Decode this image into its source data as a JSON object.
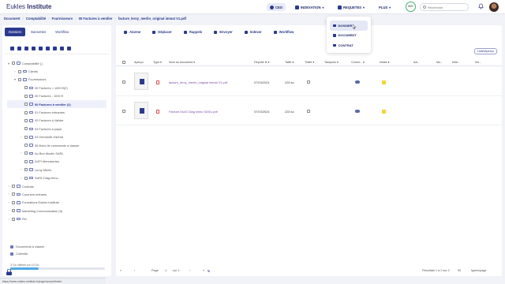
{
  "app": {
    "logo_light": "Eukles ",
    "logo_bold": "Institute"
  },
  "nav": {
    "ceo": "CEO",
    "indexation": "INDEXATION",
    "requetes": "REQUETES",
    "plus": "PLUS",
    "quota_pct": "68%"
  },
  "search": {
    "placeholder": "Recherche"
  },
  "breadcrumb": [
    "Document",
    "Comptabilité",
    "Fournisseurs",
    "00 Factures à ventiler",
    "facture_leroy_merlin_original immat V1.pdf"
  ],
  "sidebar": {
    "tabs": [
      "Dossiers",
      "Bannettes",
      "Workflow"
    ],
    "tree": [
      {
        "label": "Comptabilité (.)",
        "level": 0,
        "exp": "▾"
      },
      {
        "label": "Clients",
        "level": 1,
        "exp": "›"
      },
      {
        "label": "Fournisseurs",
        "level": 1,
        "exp": "▾"
      },
      {
        "label": "00 Factures < 1000 €(2)",
        "level": 2,
        "exp": ""
      },
      {
        "label": "00 Factures - 1000 €",
        "level": 2,
        "exp": ""
      },
      {
        "label": "00 Factures à ventiler (2)",
        "level": 2,
        "exp": "",
        "sel": true
      },
      {
        "label": "01 Factures entrantes",
        "level": 2,
        "exp": ""
      },
      {
        "label": "02 Factures à Valider",
        "level": 2,
        "exp": ""
      },
      {
        "label": "03 Factures à payer",
        "level": 2,
        "exp": ""
      },
      {
        "label": "04 Demande d'achat",
        "level": 2,
        "exp": "›"
      },
      {
        "label": "05 Bons de commande à classer",
        "level": 2,
        "exp": ""
      },
      {
        "label": "Au Bon Moulin SARL",
        "level": 2,
        "exp": "›"
      },
      {
        "label": "AXPI Menuiseries",
        "level": 2,
        "exp": ""
      },
      {
        "label": "Leroy Merlin",
        "level": 2,
        "exp": "›"
      },
      {
        "label": "SARL Diag immo",
        "level": 2,
        "exp": "›"
      },
      {
        "label": "Contrats",
        "level": 0,
        "exp": "›"
      },
      {
        "label": "Courriers entrants",
        "level": 0,
        "exp": "›"
      },
      {
        "label": "Formations Eukles Institute",
        "level": 0,
        "exp": "›"
      },
      {
        "label": "Marketing Communication (5)",
        "level": 0,
        "exp": "›"
      },
      {
        "label": "RH",
        "level": 0,
        "exp": "›"
      }
    ],
    "links": [
      "Documents à classer",
      "Corbeille"
    ],
    "quota_text": "3 Go utilisés sur 10 Go",
    "quota_fraction": 0.3
  },
  "toolbar": {
    "actions": [
      "Alarme",
      "Déplacer",
      "Rappels",
      "Envoyer",
      "Indexer",
      "Workflow"
    ],
    "list_mode": "Liste/Aperçu"
  },
  "table": {
    "headers": [
      "Aperçu",
      "Type ♦",
      "Nom du document ♦",
      "Déposé le ♦",
      "Taille ♦",
      "Traité ♦",
      "Tampons ♦",
      "Comm... ♦",
      "Notes ♦",
      "AA...",
      "Mo...",
      "Infor...",
      "Nd..."
    ],
    "rows": [
      {
        "name": "facture_leroy_merlin_original immat V1.pdf",
        "date": "07/03/2024",
        "size": "228 ko"
      },
      {
        "name": "Facture DIAG Diag immo SASU.pdf",
        "date": "07/03/2024",
        "size": "228 ko"
      }
    ]
  },
  "pager": {
    "page_label": "Page",
    "page": "1",
    "of": "sur 1",
    "results": "Résultats 1 à 2 sur 2",
    "per_page": "50",
    "per_page_label": "lignes/page"
  },
  "dropdown": {
    "items": [
      "DOSSIER",
      "DOCUMENT",
      "CONTRAT"
    ]
  },
  "status_url": "https://www.eukles-institute.fr/page/search/folder"
}
